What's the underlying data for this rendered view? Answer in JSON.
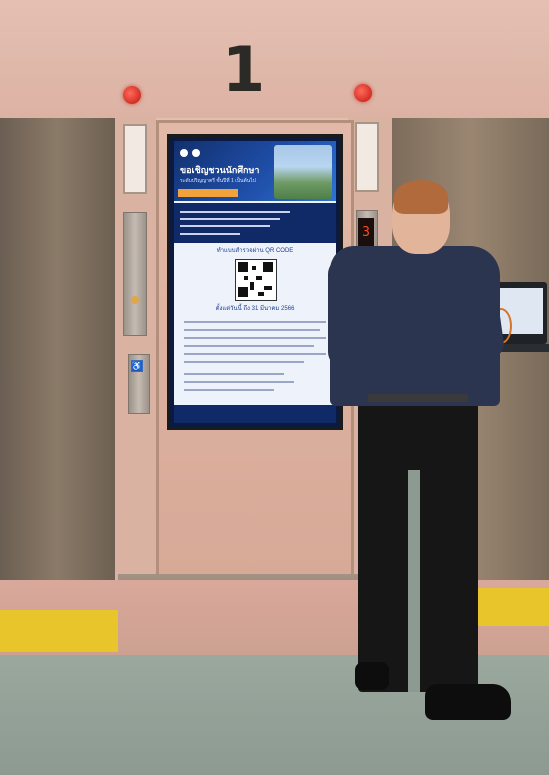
{
  "scene": {
    "elevator_floor_number": "1",
    "floor_indicator_value": "3",
    "accessibility_symbol": "♿",
    "accent_colors": {
      "navy": "#0f2a66",
      "blue": "#2d74d4",
      "orange": "#f2a23a",
      "tactile_yellow": "#e8c52a"
    }
  },
  "kiosk": {
    "title": "ขอเชิญชวนนักศึกษา",
    "subtitle": "ระดับปริญญาตรี ชั้นปีที่ 1 เป็นต้นไป",
    "qr_caption": "ทำแบบสำรวจผ่าน QR CODE",
    "date_line": "ตั้งแต่วันนี้ ถึง 31 มีนาคม 2566"
  }
}
